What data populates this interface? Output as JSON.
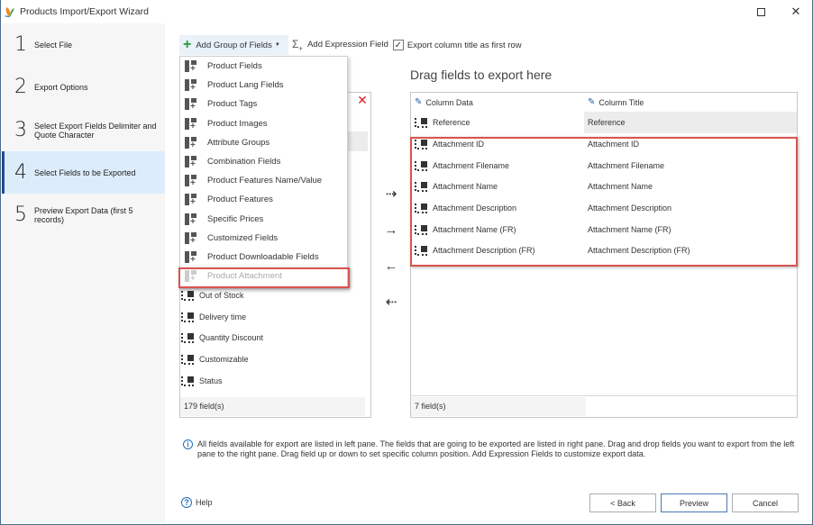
{
  "window": {
    "title": "Products Import/Export Wizard",
    "app_icon": "leaf-logo-icon",
    "maximize_icon": "maximize-icon",
    "close_icon": "close-icon"
  },
  "steps": [
    {
      "num": "1",
      "label": "Select File",
      "active": false
    },
    {
      "num": "2",
      "label": "Export Options",
      "active": false
    },
    {
      "num": "3",
      "label": "Select Export Fields Delimiter and Quote Character",
      "active": false
    },
    {
      "num": "4",
      "label": "Select Fields to be Exported",
      "active": true
    },
    {
      "num": "5",
      "label": "Preview Export Data (first 5 records)",
      "active": false
    }
  ],
  "toolbar": {
    "add_group_label": "Add Group of Fields",
    "add_expression_label": "Add Expression Field",
    "export_title_label": "Export column title as first row",
    "export_title_checked": true
  },
  "group_menu": {
    "items": [
      {
        "label": "Product Fields",
        "disabled": false
      },
      {
        "label": "Product Lang Fields",
        "disabled": false
      },
      {
        "label": "Product Tags",
        "disabled": false
      },
      {
        "label": "Product Images",
        "disabled": false
      },
      {
        "label": "Attribute Groups",
        "disabled": false
      },
      {
        "label": "Combination Fields",
        "disabled": false
      },
      {
        "label": "Product Features Name/Value",
        "disabled": false
      },
      {
        "label": "Product Features",
        "disabled": false
      },
      {
        "label": "Specific Prices",
        "disabled": false
      },
      {
        "label": "Customized Fields",
        "disabled": false
      },
      {
        "label": "Product Downloadable Fields",
        "disabled": false
      },
      {
        "label": "Product Attachment",
        "disabled": true
      }
    ]
  },
  "left_pane": {
    "fields": [
      "Out of Stock",
      "Delivery time",
      "Quantity Discount",
      "Customizable",
      "Status"
    ],
    "count_label": "179 field(s)"
  },
  "transfer_buttons": {
    "add_all": "⇢",
    "add": "→",
    "remove": "←",
    "remove_all": "⇠"
  },
  "right_pane": {
    "title": "Drag fields to export here",
    "col_data_header": "Column Data",
    "col_title_header": "Column Title",
    "rows": [
      {
        "data": "Reference",
        "title": "Reference"
      },
      {
        "data": "Attachment ID",
        "title": "Attachment ID"
      },
      {
        "data": "Attachment Filename",
        "title": "Attachment Filename"
      },
      {
        "data": "Attachment Name",
        "title": "Attachment Name"
      },
      {
        "data": "Attachment Description",
        "title": "Attachment Description"
      },
      {
        "data": "Attachment Name (FR)",
        "title": "Attachment Name (FR)"
      },
      {
        "data": "Attachment Description (FR)",
        "title": "Attachment Description (FR)"
      }
    ],
    "count_label": "7 field(s)"
  },
  "info_text": "All fields available for export are listed in left pane. The fields that are going to be exported are listed in right pane. Drag and drop fields you want to export from the left pane to the right pane. Drag field up or down to set specific column position. Add Expression Fields to customize export data.",
  "footer": {
    "help_label": "Help",
    "back_label": "< Back",
    "preview_label": "Preview",
    "cancel_label": "Cancel"
  },
  "colors": {
    "active_step_bg": "#dcecfb",
    "active_step_bar": "#1f4e8c",
    "highlight_red": "#d9534f",
    "accent_blue": "#1f6fb8",
    "plus_green": "#2a9a3a"
  }
}
